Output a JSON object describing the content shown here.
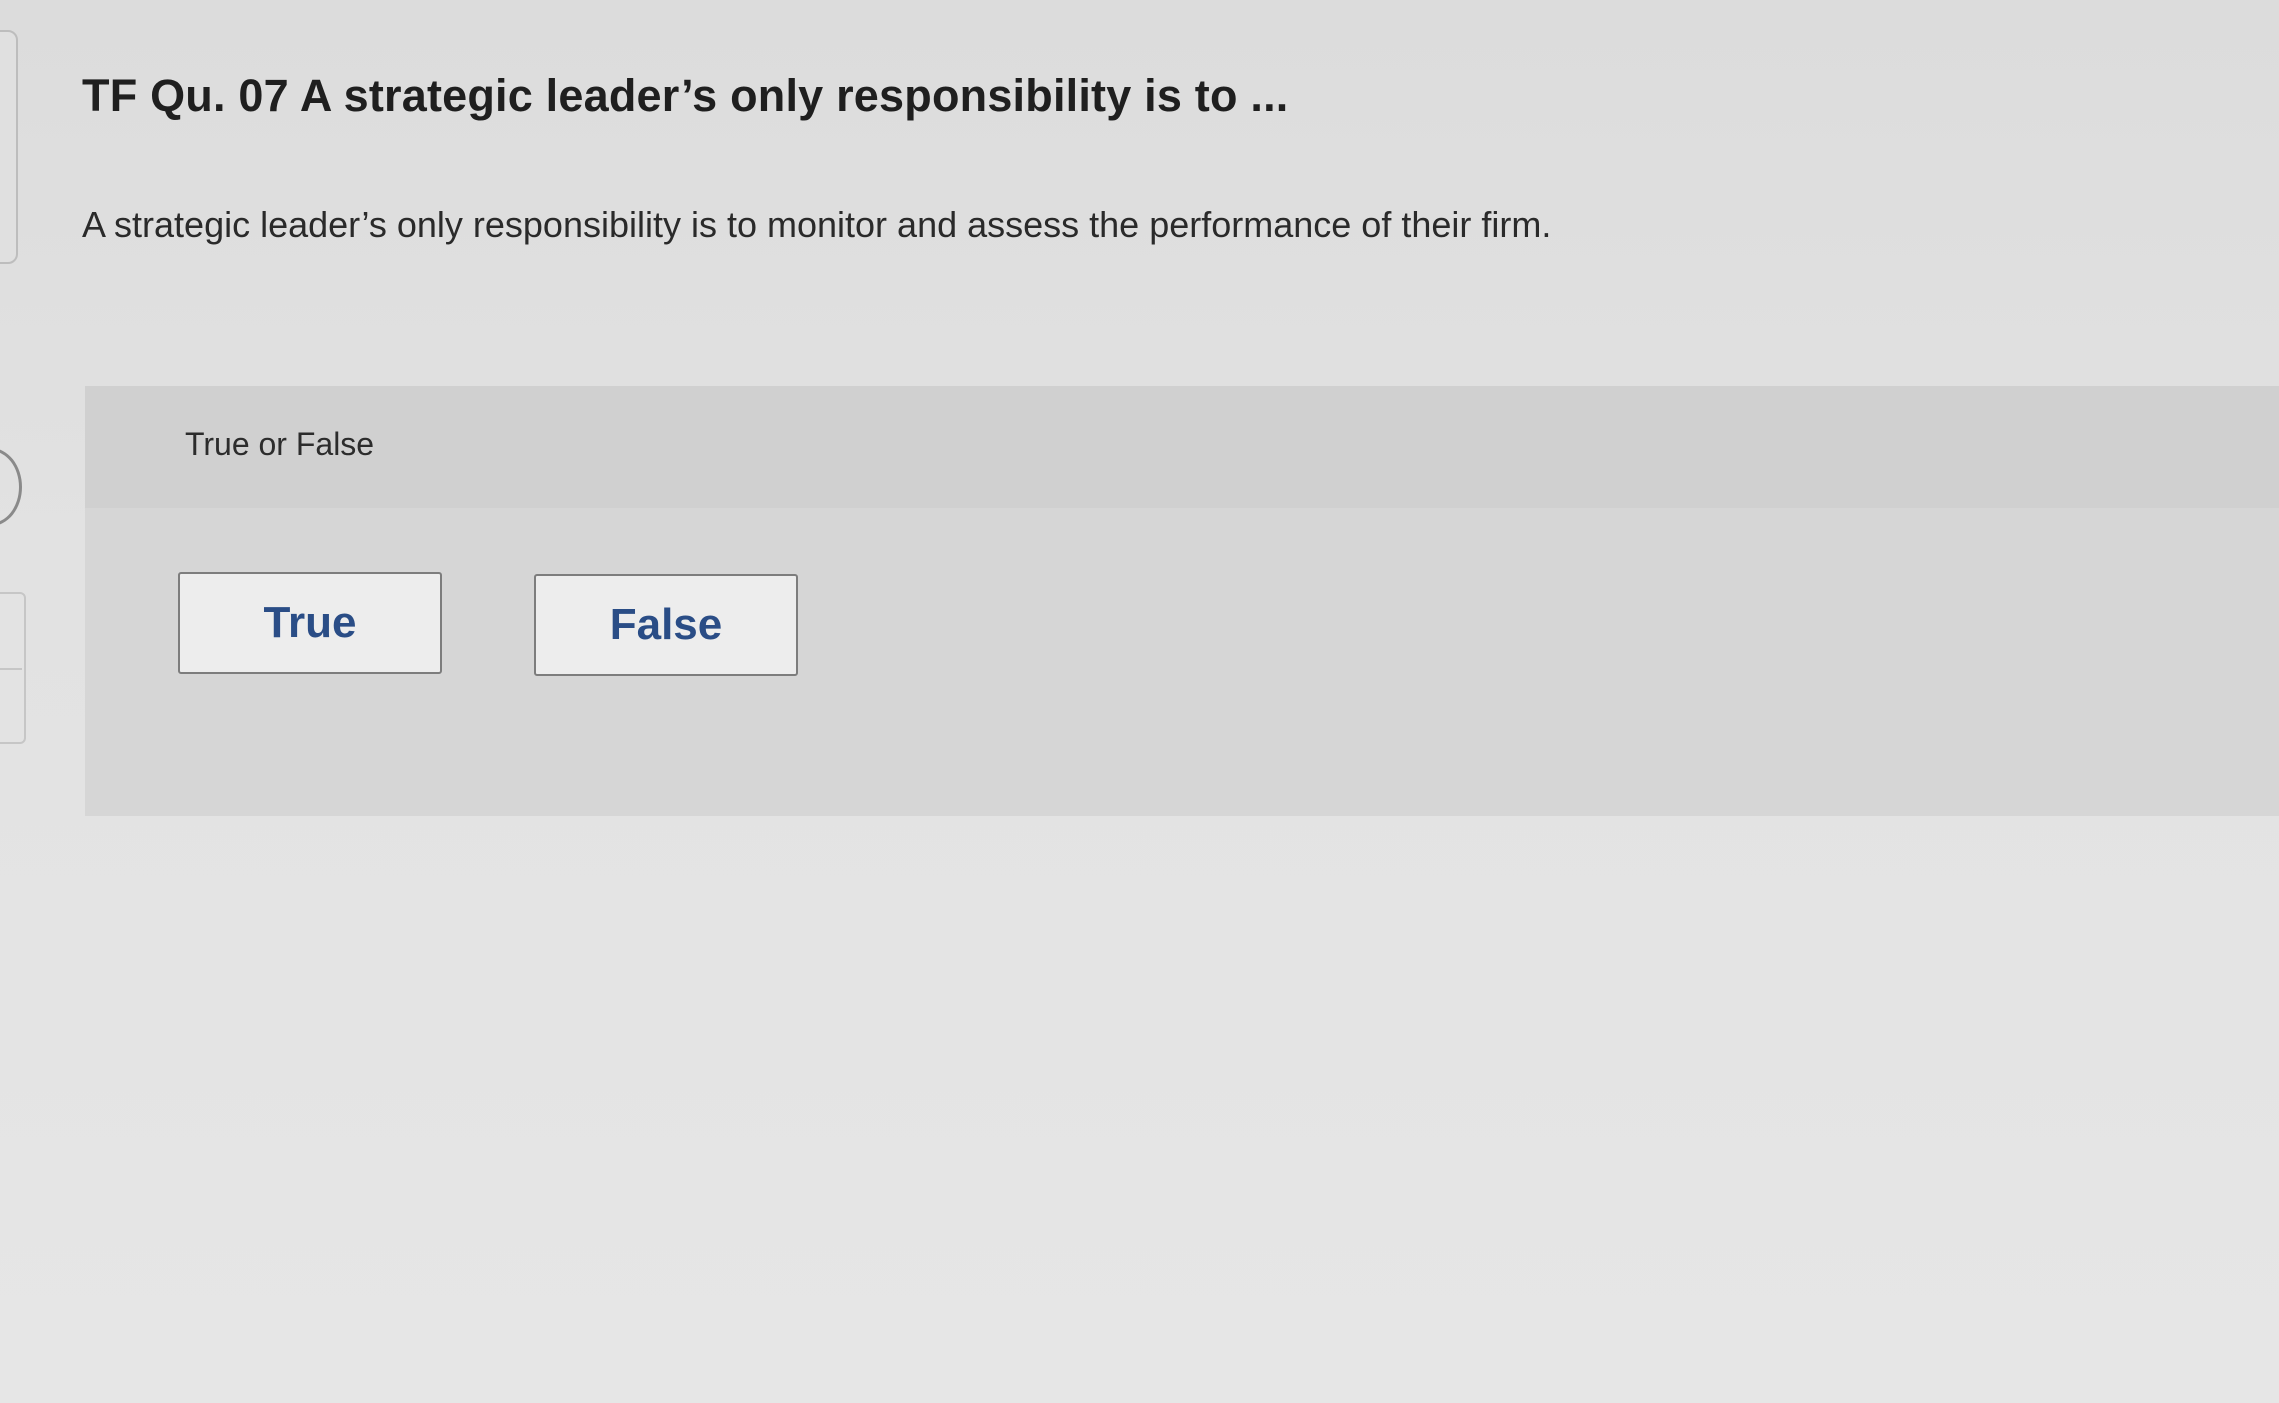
{
  "question": {
    "title": "TF Qu. 07 A strategic leader’s only responsibility is to ...",
    "text": "A strategic leader’s only responsibility is to monitor and assess the performance of their firm."
  },
  "answer_panel": {
    "instruction": "True or False",
    "options": [
      {
        "label": "True"
      },
      {
        "label": "False"
      }
    ]
  },
  "colors": {
    "button_text": "#2a4d86",
    "panel_background": "#d6d6d6",
    "page_background": "#e2e2e2"
  }
}
